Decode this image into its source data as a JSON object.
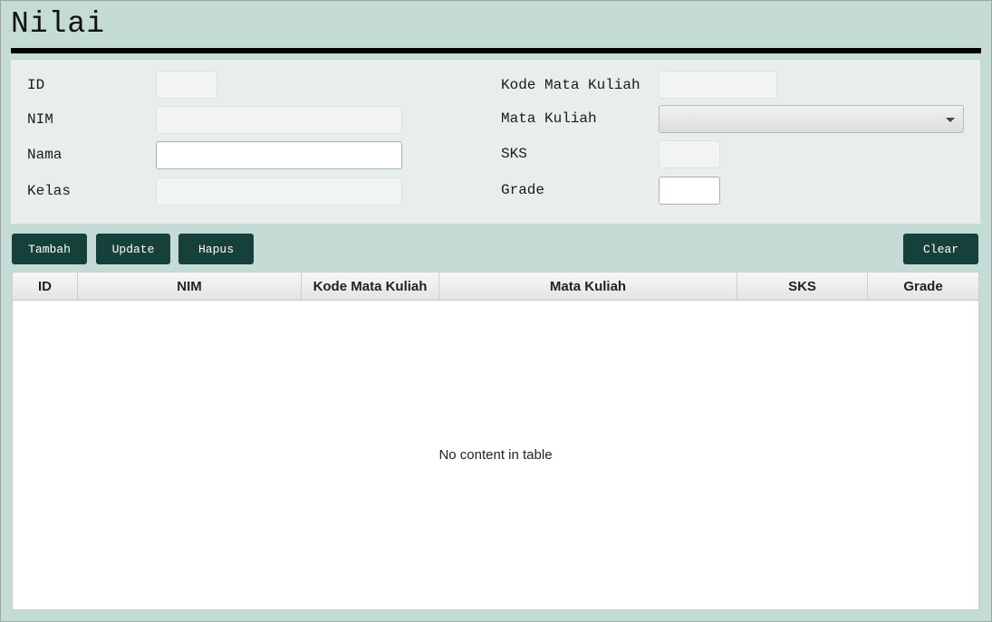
{
  "page": {
    "title": "Nilai"
  },
  "form": {
    "labels": {
      "id": "ID",
      "nim": "NIM",
      "nama": "Nama",
      "kelas": "Kelas",
      "kode_mk": "Kode Mata Kuliah",
      "mata_kuliah": "Mata Kuliah",
      "sks": "SKS",
      "grade": "Grade"
    },
    "values": {
      "id": "",
      "nim": "",
      "nama": "",
      "kelas": "",
      "kode_mk": "",
      "mata_kuliah": "",
      "sks": "",
      "grade": ""
    }
  },
  "buttons": {
    "tambah": "Tambah",
    "update": "Update",
    "hapus": "Hapus",
    "clear": "Clear"
  },
  "table": {
    "columns": [
      "ID",
      "NIM",
      "Kode Mata Kuliah",
      "Mata Kuliah",
      "SKS",
      "Grade"
    ],
    "rows": [],
    "placeholder": "No content in table"
  },
  "colors": {
    "background": "#c5dbd5",
    "panel": "#e7eeec",
    "button": "#16403a"
  }
}
